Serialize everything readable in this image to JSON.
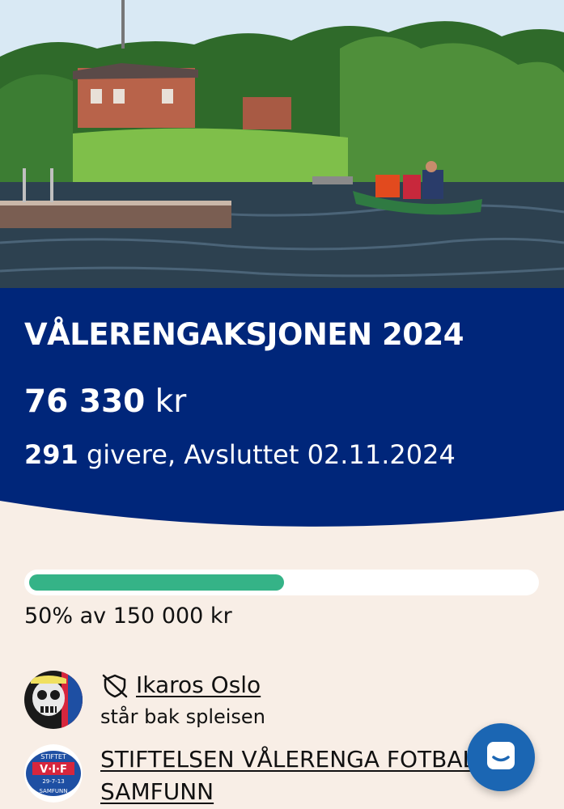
{
  "hero": {
    "image": "lake-canoe-photo",
    "colors": {
      "sky": "#d9e9f4",
      "trees": "#2f6a2a",
      "grass": "#7fbf4a",
      "water": "#2d4150",
      "building": "#b8634a"
    }
  },
  "campaign": {
    "title": "VÅLERENGAKSJONEN 2024",
    "amount": "76 330",
    "currency": "kr",
    "donor_count": "291",
    "donors_text": "givere, Avsluttet 02.11.2024",
    "banner_color": "#00267a"
  },
  "progress": {
    "fraction": 0.5,
    "label": "50% av 150 000 kr",
    "fill_color": "#35b387"
  },
  "organizer": {
    "name": "Ikaros Oslo",
    "subtitle": "står bak spleisen",
    "icon": "shield-off-icon"
  },
  "recipient": {
    "name_line1": "STIFTELSEN VÅLERENGA FOTBALL",
    "name_line2": "SAMFUNN",
    "logo_text_top": "STIFTET",
    "logo_text_mid": "V·I·F",
    "logo_date": "29-7-13",
    "logo_text_bottom": "SAMFUNN"
  },
  "chat": {
    "icon": "chat-icon",
    "color": "#1b66b3"
  }
}
